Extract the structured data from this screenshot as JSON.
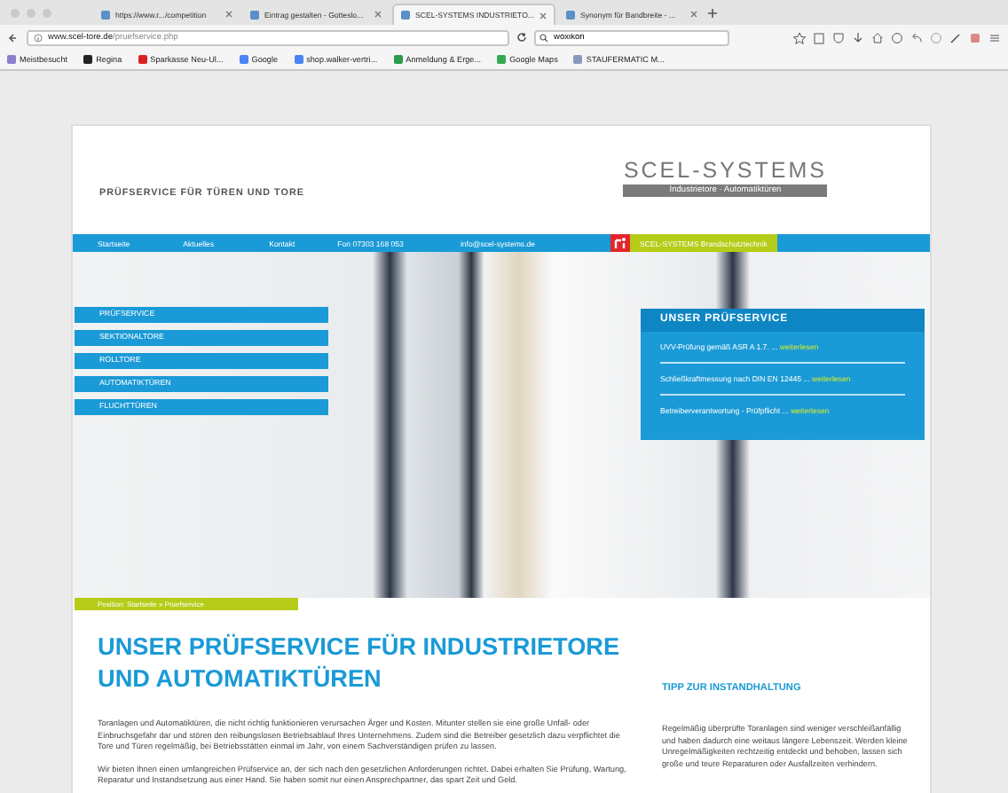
{
  "browser": {
    "tabs": [
      {
        "title": "https://www.r.../competition",
        "selected": false
      },
      {
        "title": "Eintrag gestalten - Gotteslo...",
        "selected": false
      },
      {
        "title": "SCEL-SYSTEMS INDUSTRIETO...",
        "selected": true
      },
      {
        "title": "Synonym für Bandbreite - ...",
        "selected": false
      }
    ],
    "url": "**www.scel-tore.de**/pruefservice.php",
    "search": {
      "value": "woxikon"
    },
    "bookmarks": [
      "Meistbesucht",
      "Regina",
      "Sparkasse Neu-Ul...",
      "Google",
      "shop.walker-vertri...",
      "Anmeldung & Erge...",
      "Google Maps",
      "STAUFERMATIC M..."
    ]
  },
  "page": {
    "tagline": "PRÜFSERVICE FÜR TÜREN UND TORE",
    "logo": {
      "name": "SCEL-SYSTEMS",
      "subtitle": "Industrietore · Automatiktüren"
    },
    "nav": [
      "Startseite",
      "Aktuelles",
      "Kontakt",
      "Fon 07303 168 053",
      "info@scel-systems.de"
    ],
    "nav_badge": "SCEL-SYSTEMS Brandschutztechnik",
    "side_menu": [
      "PRÜFSERVICE",
      "SEKTIONALTORE",
      "ROLLTORE",
      "AUTOMATIKTÜREN",
      "FLUCHTTÜREN"
    ],
    "info_box": {
      "title": "UNSER PRÜFSERVICE",
      "items": [
        {
          "text": "UVV-Prüfung gemäß ASR A 1.7. ...",
          "link": "weiterlesen"
        },
        {
          "text": "Schließkraftmessung nach DIN EN 12445 ...",
          "link": "weiterlesen"
        },
        {
          "text": "Betreiberverantwortung - Prüfpflicht ...",
          "link": "weiterlesen"
        }
      ]
    },
    "breadcrumb": "Position: Startseite » Pruefservice",
    "heading": "UNSER PRÜFSERVICE FÜR INDUSTRIETORE UND AUTOMATIKTÜREN",
    "paragraphs": [
      "Toranlagen und Automatiktüren, die nicht richtig funktionieren verursachen Ärger und Kosten. Mitunter stellen sie eine große Unfall- oder Einbruchsgefahr dar und stören den reibungslosen Betriebsablauf Ihres Unternehmens. Zudem sind die Betreiber gesetzlich dazu verpflichtet die Tore und Türen regelmäßig, bei Betriebsstätten einmal im Jahr, von einem Sachverständigen prüfen zu lassen.",
      "Wir bieten Ihnen einen umfangreichen Prüfservice an, der sich nach den gesetzlichen Anforderungen richtet. Dabei erhalten Sie Prüfung, Wartung, Reparatur und Instandsetzung aus einer Hand. Sie haben somit nur einen Ansprechpartner, das spart Zeit und Geld."
    ],
    "tip": {
      "title": "TIPP ZUR INSTANDHALTUNG",
      "text": "Regelmäßig überprüfte Toranlagen sind weniger verschleißanfällig und haben dadurch eine weitaus längere Lebenszeit. Werden kleine Unregelmäßigkeiten rechtzeitig entdeckt und behoben, lassen sich große und teure Reparaturen oder Ausfallzeiten verhindern."
    }
  }
}
